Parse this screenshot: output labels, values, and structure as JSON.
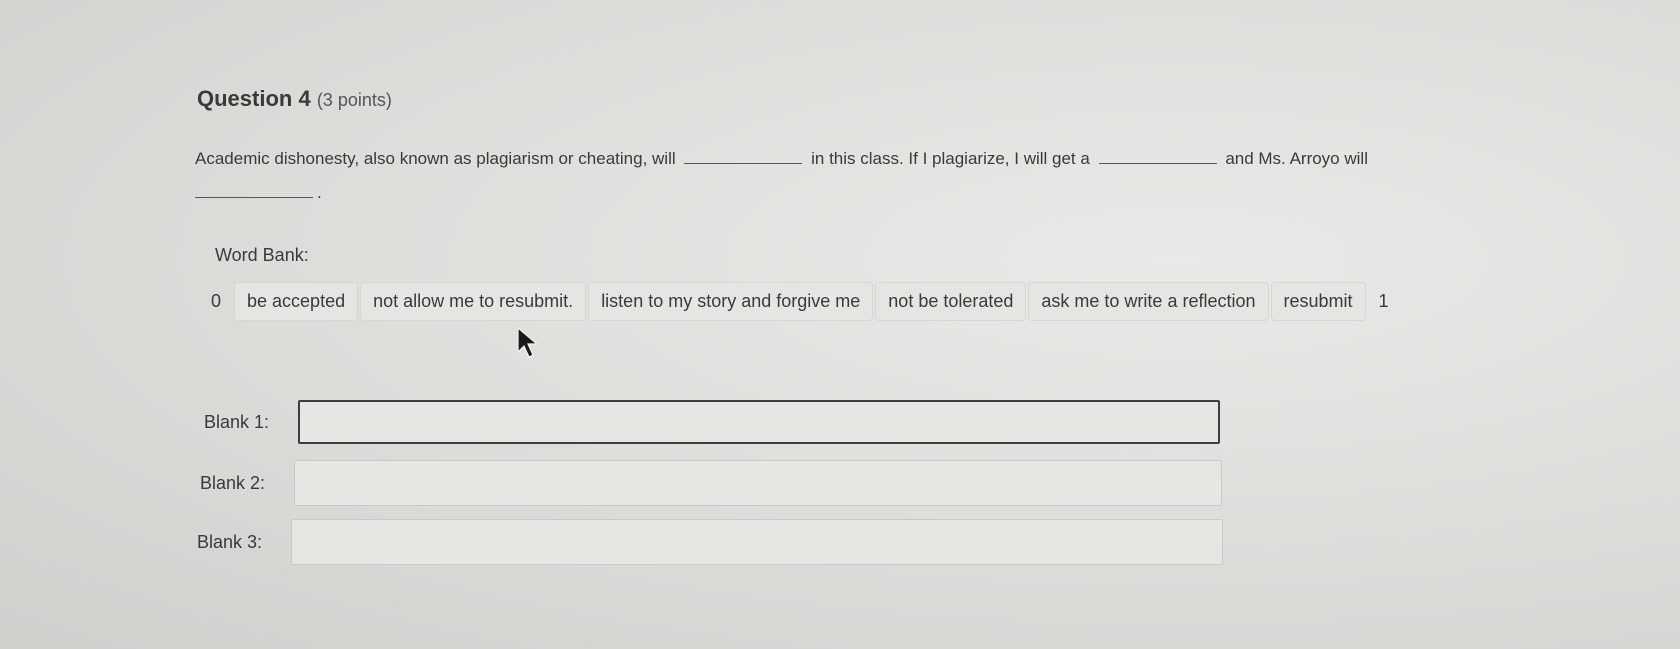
{
  "question": {
    "title": "Question 4",
    "points": "(3 points)",
    "text_part1": "Academic dishonesty, also known as plagiarism or cheating, will",
    "text_part2": "in this class. If I plagiarize, I will get a",
    "text_part3": "and Ms. Arroyo will",
    "text_end": "."
  },
  "word_bank": {
    "label": "Word Bank:",
    "items": [
      "0",
      "be accepted",
      "not allow me to resubmit.",
      "listen to my story and forgive me",
      "not be tolerated",
      "ask me to write a reflection",
      "resubmit",
      "1"
    ]
  },
  "blanks": [
    {
      "label": "Blank 1:",
      "value": ""
    },
    {
      "label": "Blank 2:",
      "value": ""
    },
    {
      "label": "Blank 3:",
      "value": ""
    }
  ]
}
